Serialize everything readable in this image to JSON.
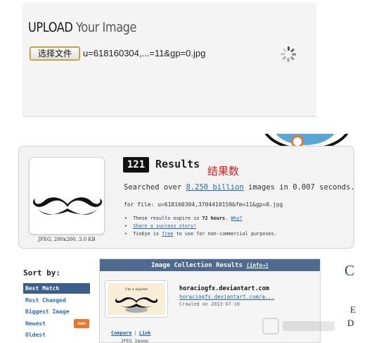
{
  "upload": {
    "title_strong": "UPLOAD",
    "title_light": "Your Image",
    "file_button_label": "选择文件",
    "file_name": "u=618160304,...=11&gp=0.jpg"
  },
  "results": {
    "count": "121",
    "results_label": "Results",
    "annotation": "结果数",
    "searched_prefix": "Searched over",
    "searched_link": "8.250 billion",
    "searched_suffix": "images in 0.007 seconds.",
    "for_file": "for file: u=618160304,3704410159&fm=11&gp=0.jpg",
    "thumb_caption": "JPEG, 200x200, 3.0 KB",
    "bullet1_prefix": "These results expire in",
    "bullet1_bold": "72 hours",
    "bullet1_link": "Why?",
    "bullet2_link": "Share a success story!",
    "bullet3_prefix": "TinEye is",
    "bullet3_link": "free",
    "bullet3_suffix": "to use for non-commercial purposes."
  },
  "sort": {
    "label": "Sort by:",
    "items": [
      {
        "label": "Best Match",
        "active": true
      },
      {
        "label": "Most Changed"
      },
      {
        "label": "Biggest Image"
      },
      {
        "label": "Newest",
        "badge": "new"
      },
      {
        "label": "Oldest"
      }
    ]
  },
  "collection": {
    "header": "Image Collection Results",
    "info_link": "(info→)",
    "thumb_label": "I'm a hipster",
    "site": "horaciogfx.deviantart.com",
    "site_url": "horaciogfx.deviantart.com/a...",
    "crawled": "Crawled on 2013-07-10",
    "compare_link": "Compare",
    "link_link": "Link",
    "separator": "|",
    "image_type": "JPEG Image"
  },
  "edge_letters": {
    "c": "C",
    "e": "E",
    "d": "D"
  },
  "colors": {
    "accent_blue": "#2266aa",
    "header_blue": "#4e6a8e",
    "active_sort": "#3b5e8c",
    "annotation_red": "#e0191d",
    "badge_orange": "#e8772e"
  }
}
